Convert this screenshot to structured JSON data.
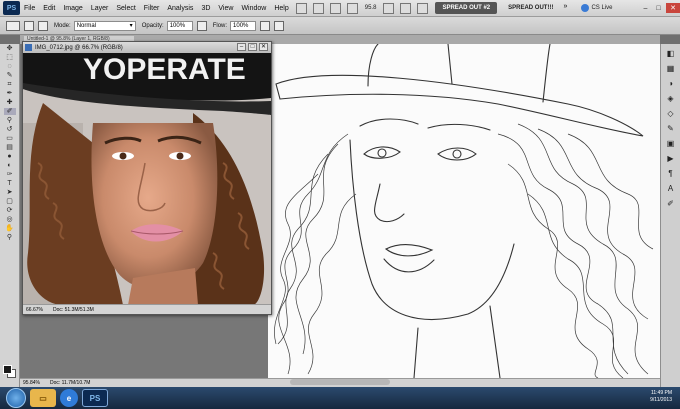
{
  "app": {
    "logo_text": "PS"
  },
  "menu": {
    "items": [
      "File",
      "Edit",
      "Image",
      "Layer",
      "Select",
      "Filter",
      "Analysis",
      "3D",
      "View",
      "Window",
      "Help"
    ],
    "zoom_level": "95.8",
    "workspaces": [
      "SPREAD OUT #2",
      "SPREAD OUT!!!"
    ],
    "cs_live": "CS Live"
  },
  "options": {
    "mode_label": "Mode:",
    "mode_value": "Normal",
    "opacity_label": "Opacity:",
    "opacity_value": "100%",
    "flow_label": "Flow:",
    "flow_value": "100%"
  },
  "photo_window": {
    "title": "IMG_0712.jpg @ 66.7% (RGB/8)",
    "zoom": "66.67%",
    "doc": "Doc: 51.3M/51.3M",
    "cap_text": "YOPERATE"
  },
  "tab": {
    "title": "Untitled-1 @ 95.8% (Layer 1, RGB/8)"
  },
  "status": {
    "zoom": "95.84%",
    "doc": "Doc: 11.7M/10.7M"
  },
  "taskbar": {
    "time": "11:49 PM",
    "date": "9/11/2013"
  },
  "colors": {
    "accent": "#0c2a52",
    "taskbar": "#1d3554"
  }
}
